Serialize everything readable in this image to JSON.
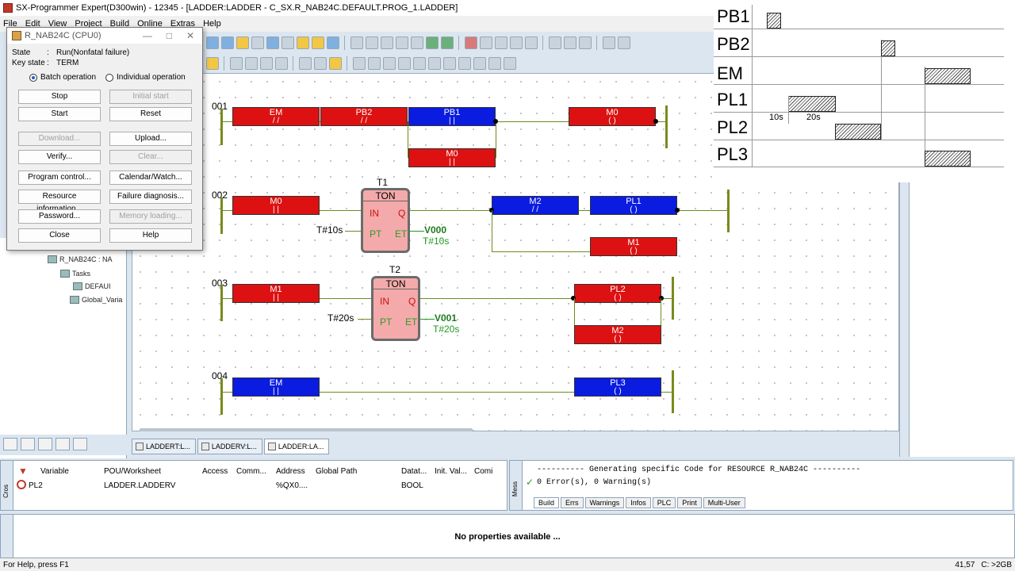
{
  "window": {
    "title": "SX-Programmer Expert(D300win) - 12345 - [LADDER:LADDER - C_SX.R_NAB24C.DEFAULT.PROG_1.LADDER]"
  },
  "menu": [
    "File",
    "Edit",
    "View",
    "Project",
    "Build",
    "Online",
    "Extras",
    "Help"
  ],
  "dialog": {
    "title": "R_NAB24C (CPU0)",
    "state_label": "State",
    "state_value": "Run(Nonfatal failure)",
    "key_label": "Key state",
    "key_value": "TERM",
    "radio_batch": "Batch operation",
    "radio_individual": "Individual operation",
    "buttons": {
      "stop": "Stop",
      "initial_start": "Initial start",
      "start": "Start",
      "reset": "Reset",
      "download": "Download...",
      "upload": "Upload...",
      "verify": "Verify...",
      "clear": "Clear...",
      "program_control": "Program control...",
      "calendar": "Calendar/Watch...",
      "resource_info": "Resource information...",
      "failure_diag": "Failure diagnosis...",
      "password": "Password...",
      "memory_loading": "Memory loading...",
      "close": "Close",
      "help": "Help"
    }
  },
  "tree": {
    "resource": "R_NAB24C : NA",
    "tasks": "Tasks",
    "default": "DEFAUI",
    "global": "Global_Varia"
  },
  "ladder": {
    "rungs": [
      "001",
      "002",
      "003",
      "004"
    ],
    "r1": {
      "em": "EM",
      "pb2": "PB2",
      "pb1": "PB1",
      "m0": "M0",
      "m0_branch": "M0"
    },
    "r2": {
      "m0": "M0",
      "t_name": "T1",
      "t_type": "TON",
      "in": "IN",
      "q": "Q",
      "pt": "PT",
      "et": "ET",
      "pt_val": "T#10s",
      "et_var": "V000",
      "et_val": "T#10s",
      "m2": "M2",
      "pl1": "PL1",
      "m1": "M1"
    },
    "r3": {
      "m1": "M1",
      "t_name": "T2",
      "t_type": "TON",
      "in": "IN",
      "q": "Q",
      "pt": "PT",
      "et": "ET",
      "pt_val": "T#20s",
      "et_var": "V001",
      "et_val": "T#20s",
      "pl2": "PL2",
      "m2": "M2"
    },
    "r4": {
      "em": "EM",
      "pl3": "PL3"
    }
  },
  "timing": {
    "signals": [
      "PB1",
      "PB2",
      "EM",
      "PL1",
      "PL2",
      "PL3"
    ],
    "label_10s": "10s",
    "label_20s": "20s"
  },
  "doc_tabs": [
    "LADDERT:L...",
    "LADDERV:L...",
    "LADDER:LA..."
  ],
  "var_table": {
    "headers": [
      "Variable",
      "POU/Worksheet",
      "Access",
      "Comm...",
      "Address",
      "Global Path",
      "Datat...",
      "Init. Val...",
      "Comi"
    ],
    "row": {
      "variable": "PL2",
      "pou": "LADDER.LADDERV",
      "address": "%QX0....",
      "datatype": "BOOL"
    },
    "side_label": "Cros"
  },
  "messages": {
    "line1": "---------- Generating specific Code for RESOURCE R_NAB24C ----------",
    "line2": "0 Error(s), 0 Warning(s)",
    "tabs": [
      "Build",
      "Errs",
      "Warnings",
      "Infos",
      "PLC",
      "Print",
      "Multi-User"
    ],
    "side_label": "Mess"
  },
  "properties": {
    "empty": "No properties available ..."
  },
  "status": {
    "left": "For Help, press F1",
    "pos": "41,57",
    "disk": "C: >2GB"
  },
  "colors": {
    "contact_red": "#dd1111",
    "contact_blue": "#0a1ce0",
    "timer_fill": "#f4aaaa",
    "wire": "#6b8c1e"
  }
}
